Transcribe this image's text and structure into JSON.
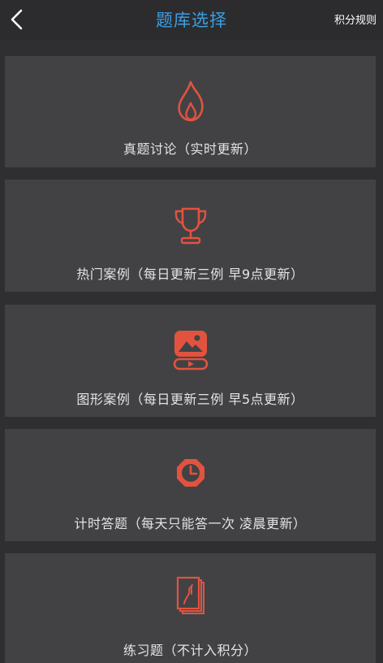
{
  "header": {
    "title": "题库选择",
    "rules_label": "积分规则"
  },
  "cards": [
    {
      "label": "真题讨论（实时更新）",
      "icon": "flame-icon"
    },
    {
      "label": "热门案例（每日更新三例 早9点更新）",
      "icon": "trophy-icon"
    },
    {
      "label": "图形案例（每日更新三例 早5点更新）",
      "icon": "image-video-icon"
    },
    {
      "label": "计时答题（每天只能答一次 凌晨更新）",
      "icon": "clock-icon"
    },
    {
      "label": "练习题（不计入积分）",
      "icon": "document-stack-icon"
    }
  ],
  "colors": {
    "accent": "#e2533f",
    "title": "#3a9fe6",
    "card_bg": "#424245",
    "page_bg": "#2f2f31"
  }
}
